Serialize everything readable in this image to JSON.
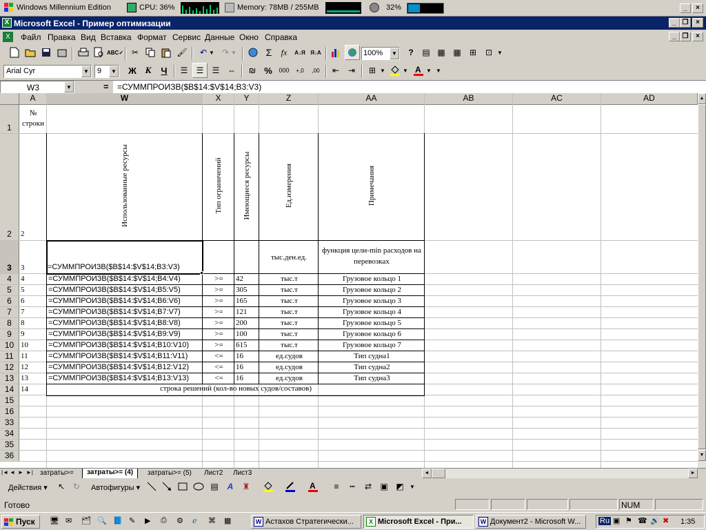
{
  "monitor": {
    "os": "Windows Millennium Edition",
    "cpu": "CPU: 36%",
    "memory": "Memory: 78MB / 255MB",
    "disk": "32%",
    "disk_level": 0.32
  },
  "window": {
    "title": "Microsoft Excel - Пример оптимизации"
  },
  "menu": [
    "Файл",
    "Правка",
    "Вид",
    "Вставка",
    "Формат",
    "Сервис",
    "Данные",
    "Окно",
    "Справка"
  ],
  "toolbar": {
    "zoom": "100%",
    "font": "Arial Cyr",
    "size": "9",
    "bold": "Ж",
    "italic": "К",
    "underline": "Ч",
    "sigma": "Σ",
    "fx": "fx",
    "currency": "%",
    "thousands": "000"
  },
  "formula_bar": {
    "name_box": "W3",
    "eq": "=",
    "formula": "=СУММПРОИЗВ($B$14:$V$14;B3:V3)"
  },
  "columns": [
    "A",
    "W",
    "X",
    "Y",
    "Z",
    "AA",
    "AB",
    "AC",
    "AD"
  ],
  "rows": [
    "1",
    "2",
    "3",
    "4",
    "5",
    "6",
    "7",
    "8",
    "9",
    "10",
    "11",
    "12",
    "13",
    "14",
    "15",
    "16",
    "33",
    "34",
    "35",
    "36"
  ],
  "header": {
    "a1": "№ строки",
    "w": "Использованные ресурсы",
    "x": "Тип ограничений",
    "y": "Имеющиеся ресурсы",
    "z": "Ед.измерения",
    "aa": "Примечания"
  },
  "table": [
    {
      "a": "2",
      "w": "",
      "x": "",
      "y": "",
      "z": "",
      "aa": ""
    },
    {
      "a": "3",
      "w": "=СУММПРОИЗВ($B$14:$V$14;B3:V3)",
      "x": "",
      "y": "",
      "z": "тыс.ден.ед.",
      "aa": "функция цели-min расходов на перевозках"
    },
    {
      "a": "4",
      "w": "=СУММПРОИЗВ($B$14:$V$14;B4:V4)",
      "x": ">=",
      "y": "42",
      "z": "тыс.т",
      "aa": "Грузовое кольцо 1"
    },
    {
      "a": "5",
      "w": "=СУММПРОИЗВ($B$14:$V$14;B5:V5)",
      "x": ">=",
      "y": "305",
      "z": "тыс.т",
      "aa": "Грузовое кольцо 2"
    },
    {
      "a": "6",
      "w": "=СУММПРОИЗВ($B$14:$V$14;B6:V6)",
      "x": ">=",
      "y": "165",
      "z": "тыс.т",
      "aa": "Грузовое кольцо 3"
    },
    {
      "a": "7",
      "w": "=СУММПРОИЗВ($B$14:$V$14;B7:V7)",
      "x": ">=",
      "y": "121",
      "z": "тыс.т",
      "aa": "Грузовое кольцо 4"
    },
    {
      "a": "8",
      "w": "=СУММПРОИЗВ($B$14:$V$14;B8:V8)",
      "x": ">=",
      "y": "200",
      "z": "тыс.т",
      "aa": "Грузовое кольцо 5"
    },
    {
      "a": "9",
      "w": "=СУММПРОИЗВ($B$14:$V$14;B9:V9)",
      "x": ">=",
      "y": "100",
      "z": "тыс.т",
      "aa": "Грузовое кольцо 6"
    },
    {
      "a": "10",
      "w": "=СУММПРОИЗВ($B$14:$V$14;B10:V10)",
      "x": ">=",
      "y": "615",
      "z": "тыс.т",
      "aa": "Грузовое кольцо 7"
    },
    {
      "a": "11",
      "w": "=СУММПРОИЗВ($B$14:$V$14;B11:V11)",
      "x": "<=",
      "y": "16",
      "z": "ед.судов",
      "aa": "Тип судна1"
    },
    {
      "a": "12",
      "w": "=СУММПРОИЗВ($B$14:$V$14;B12:V12)",
      "x": "<=",
      "y": "16",
      "z": "ед.судов",
      "aa": "Тип судна2"
    },
    {
      "a": "13",
      "w": "=СУММПРОИЗВ($B$14:$V$14;B13:V13)",
      "x": "<=",
      "y": "16",
      "z": "ед.судов",
      "aa": "Тип судна3"
    }
  ],
  "row14": {
    "a": "14",
    "text": "строка решений (кол-во новых судов/составов)"
  },
  "sheets": [
    "затраты>=",
    "затраты>= (4)",
    "затраты>= (5)",
    "Лист2",
    "Лист3"
  ],
  "draw": {
    "actions": "Действия",
    "autoshapes": "Автофигуры"
  },
  "status": {
    "text": "Готово",
    "num": "NUM"
  },
  "taskbar": {
    "start": "Пуск",
    "tasks": [
      "Астахов Стратегически...",
      "Microsoft Excel - При...",
      "Документ2 - Microsoft W..."
    ],
    "lang": "Ru",
    "clock": "1:35"
  }
}
